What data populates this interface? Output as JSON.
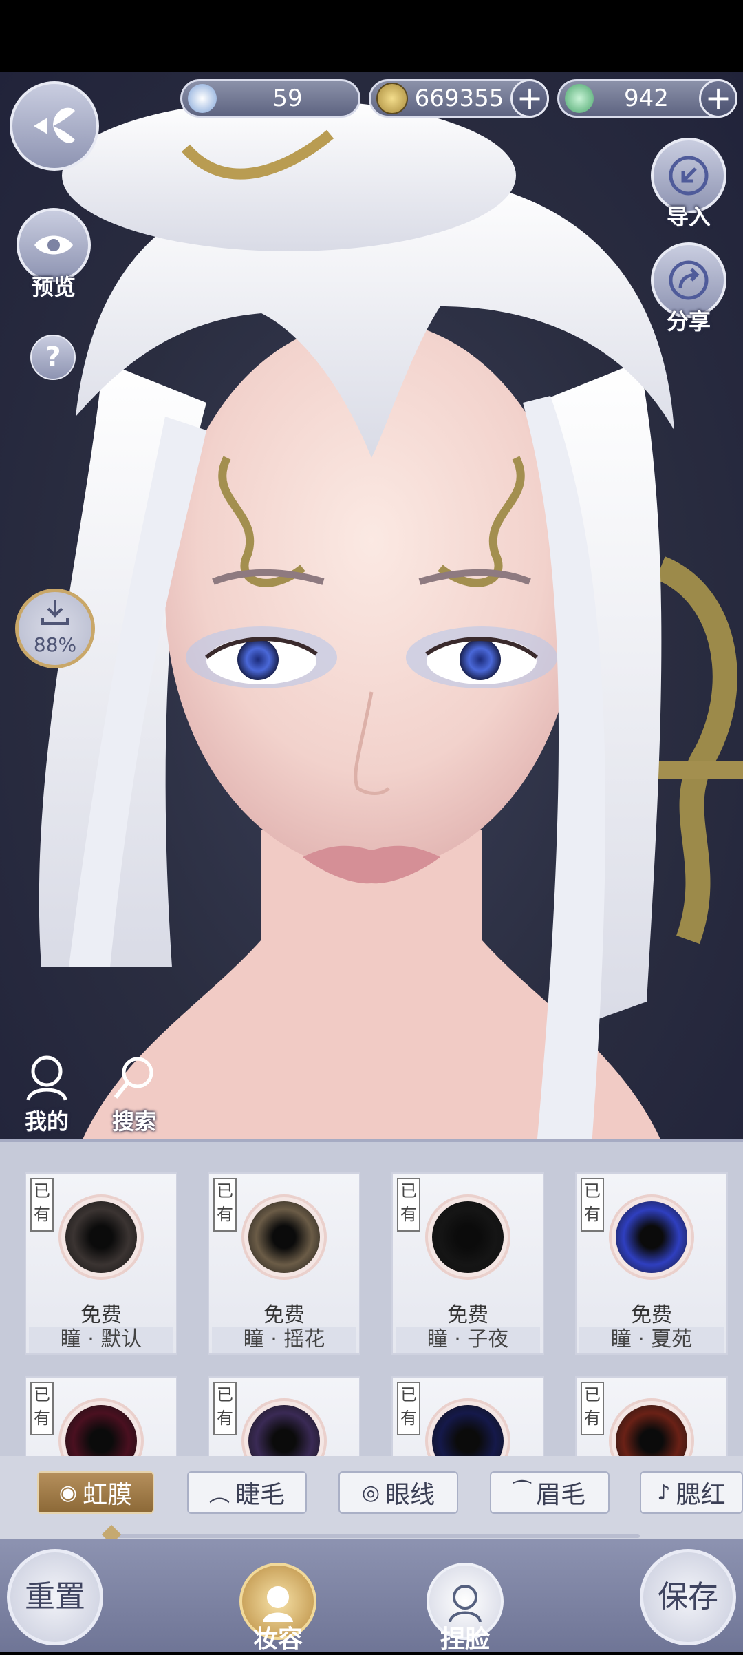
{
  "currencies": [
    {
      "name": "jade-currency",
      "value": "59",
      "has_plus": false
    },
    {
      "name": "copper-coin",
      "value": "669355",
      "has_plus": true
    },
    {
      "name": "green-gem",
      "value": "942",
      "has_plus": true
    }
  ],
  "left_controls": {
    "preview_label": "预览",
    "help_symbol": "?",
    "download_progress": "88%"
  },
  "right_controls": {
    "import_label": "导入",
    "share_label": "分享"
  },
  "quick_actions": {
    "mine_label": "我的",
    "search_label": "搜索"
  },
  "items": [
    {
      "owned_badge": "已有",
      "price": "免费",
      "name": "瞳 · 默认",
      "color": "#3b3432"
    },
    {
      "owned_badge": "已有",
      "price": "免费",
      "name": "瞳 · 摇花",
      "color": "#6b5c47"
    },
    {
      "owned_badge": "已有",
      "price": "免费",
      "name": "瞳 · 子夜",
      "color": "#151515"
    },
    {
      "owned_badge": "已有",
      "price": "免费",
      "name": "瞳 · 夏苑",
      "color": "#2f3fbf"
    },
    {
      "owned_badge": "已有",
      "price": "",
      "name": "",
      "color": "#4a1020"
    },
    {
      "owned_badge": "已有",
      "price": "",
      "name": "",
      "color": "#3a2a55"
    },
    {
      "owned_badge": "已有",
      "price": "",
      "name": "",
      "color": "#15194a"
    },
    {
      "owned_badge": "已有",
      "price": "",
      "name": "",
      "color": "#6a2116"
    }
  ],
  "tabs": [
    {
      "label": "虹膜",
      "active": true,
      "icon": "iris-icon"
    },
    {
      "label": "睫毛",
      "active": false,
      "icon": "eyelash-icon"
    },
    {
      "label": "眼线",
      "active": false,
      "icon": "eye-icon"
    },
    {
      "label": "眉毛",
      "active": false,
      "icon": "eyebrow-icon"
    },
    {
      "label": "腮红",
      "active": false,
      "icon": "blush-icon"
    }
  ],
  "bottom_nav": {
    "reset_label": "重置",
    "makeup_label": "妆容",
    "face_label": "捏脸",
    "save_label": "保存"
  },
  "colors": {
    "accent_gold": "#9c7845",
    "panel": "#c6cad9",
    "nav": "#7c82a3"
  }
}
